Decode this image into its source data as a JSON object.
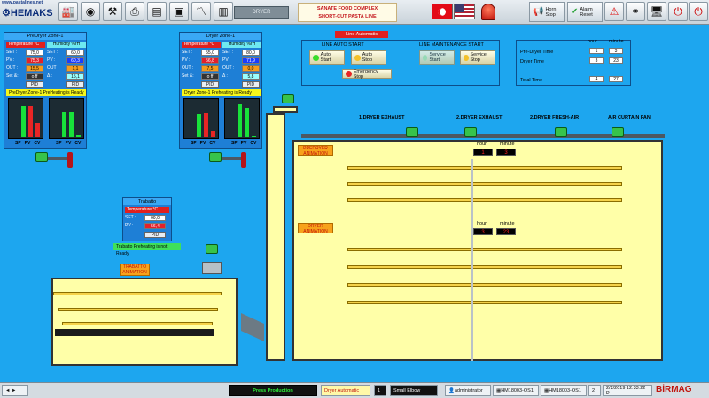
{
  "header": {
    "logo_url": "www.pastalines.net",
    "logo_name": "HEMAKS",
    "dryer_field": "DRYER",
    "title_line1": "SANATE FOOD COMPLEX",
    "title_line2": "SHORT-CUT PASTA  LINE",
    "horn_stop": [
      "Horn",
      "Stop"
    ],
    "alarm_reset": [
      "Alarm",
      "Reset"
    ],
    "toolbar_icons": [
      "factory-icon",
      "binoculars-icon",
      "tools-icon",
      "printer-icon",
      "document-icon",
      "machine-icon",
      "settings-icon",
      "trend-chart-icon",
      "chart-icon",
      "computer-icon",
      "wrench-icon"
    ]
  },
  "predryer": {
    "title": "PreDryer Zone-1",
    "temp_label": "Temperature  °C",
    "hum_label": "Humidity  %rH",
    "set_label": "SET :",
    "pv_label": "PV :",
    "out_label": "OUT :",
    "setd_label": "Set &:",
    "delta": "Δ :",
    "temp_set": "75,0",
    "temp_pv": "75,3",
    "temp_out": "15,5",
    "temp_setd": "o ff",
    "hum_set": "60,0",
    "hum_pv": "60,3",
    "hum_out": "1,1",
    "hum_delta": "15,1",
    "pid": "PID",
    "ready": "PreDryer Zone-1 PreHeating is Ready",
    "gauge_labels": [
      "SP",
      "PV",
      "CV"
    ],
    "temp_fill": [
      0.78,
      0.78,
      0.35
    ],
    "hum_fill": [
      0.62,
      0.62,
      0.05
    ]
  },
  "dryer": {
    "title": "Dryer Zone-1",
    "temp_label": "Temperature  °C",
    "hum_label": "Humidity  %rH",
    "set_label": "SET :",
    "pv_label": "PV :",
    "out_label": "OUT :",
    "setd_label": "Set &:",
    "delta": "Δ :",
    "temp_set": "55,0",
    "temp_pv": "56,8",
    "temp_out": "7,5",
    "temp_setd": "o ff",
    "hum_set": "80,0",
    "hum_pv": "71,9",
    "hum_out": "0,0",
    "hum_delta": "5,8",
    "pid": "PID",
    "ready": "Dryer Zone-1 Preheating is Ready",
    "gauge_labels": [
      "SP",
      "PV",
      "CV"
    ],
    "temp_fill": [
      0.58,
      0.6,
      0.15
    ],
    "hum_fill": [
      0.82,
      0.72,
      0.02
    ]
  },
  "trabatto": {
    "title": "Trabatto",
    "temp_label": "Temperature °C",
    "set_label": "SET :",
    "pv_label": "PV :",
    "set": "99,0",
    "pv": "56,4",
    "pid": "PID",
    "ready": "Trabatto Preheating is not Ready",
    "animation": "TRABATTO ANIMATION"
  },
  "line_control": {
    "status": "Line Automatic",
    "auto_start_title": "LINE AUTO START",
    "maint_start_title": "LINE MAINTENANCE START",
    "auto_start": "Auto Start",
    "auto_stop": "Auto Stop",
    "emergency_stop": "Emergency Stop",
    "service_start": "Service Start",
    "service_stop": "Service Stop"
  },
  "timing": {
    "hour_label": "hour",
    "minute_label": "minute",
    "rows": [
      {
        "label": "Pre-Dryer Time",
        "hour": "1",
        "minute": "3"
      },
      {
        "label": "Dryer Time",
        "hour": "3",
        "minute": "23"
      },
      {
        "label": "Total Time",
        "hour": "4",
        "minute": "27"
      }
    ]
  },
  "process": {
    "fan1": "1.DRYER EXHAUST",
    "fan2": "2.DRYER EXHAUST",
    "fan3": "2.DRYER FRESH-AIR",
    "fan4": "AIR CURTAIN FAN",
    "predryer_anim": "PREDRYER ANIMATION",
    "dryer_anim": "DRYER ANIMATION",
    "timer1_hour_label": "hour",
    "timer1_min_label": "minute",
    "timer1_hour": "1",
    "timer1_min": "3",
    "timer2_hour_label": "hour",
    "timer2_min_label": "minute",
    "timer2_hour": "3",
    "timer2_min": "23"
  },
  "statusbar": {
    "run_state": "Press Production",
    "mode": "Dryer Automatic",
    "index": "1",
    "product": "Small Elbow",
    "user": "administrator",
    "os1": "HM18003-OS1",
    "os2": "HM18003-OS1",
    "num": "2",
    "datetime": "2/2/2019 12:33:22 P",
    "brand": "BİRMAG"
  }
}
